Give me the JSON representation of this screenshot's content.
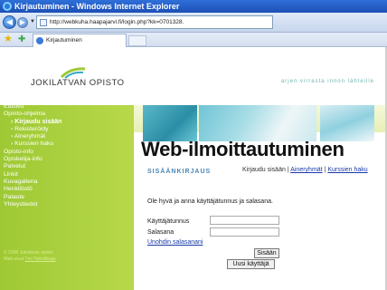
{
  "window": {
    "title": "Kirjautuminen - Windows Internet Explorer"
  },
  "addressbar": {
    "url": "http://webkuha.haapajarvi.fi/login.php?kk=0701328."
  },
  "tab": {
    "label": "Kirjautuminen"
  },
  "site": {
    "logo_text": "JOKILATVAN OPISTO",
    "tagline": "arjen virrasta innon lähteille"
  },
  "sidebar": {
    "items": [
      {
        "label": "Etusivu",
        "sub": false
      },
      {
        "label": "Opinto-ohjelma",
        "sub": false
      },
      {
        "label": "› Kirjaudu sisään",
        "sub": true,
        "active": true
      },
      {
        "label": "› Rekisteröidy",
        "sub": true
      },
      {
        "label": "› Aineryhmät",
        "sub": true
      },
      {
        "label": "› Kurssien haku",
        "sub": true
      },
      {
        "label": "Opisto-info",
        "sub": false
      },
      {
        "label": "Opiskelija-info",
        "sub": false
      },
      {
        "label": "Palvelut",
        "sub": false
      },
      {
        "label": "Linkit",
        "sub": false
      },
      {
        "label": "Kuvagalleria",
        "sub": false
      },
      {
        "label": "Henkilöstö",
        "sub": false
      },
      {
        "label": "Palaute",
        "sub": false
      },
      {
        "label": "Yhteystiedot",
        "sub": false
      }
    ],
    "footer_line1": "© 2008 Jokilatvan opisto",
    "footer_line2": "Web-sivut ",
    "footer_link": "Tmi Tekniikkaja"
  },
  "main": {
    "heading": "Web-ilmoittautuminen",
    "section_title": "SISÄÄNKIRJAUS",
    "links": {
      "login": "Kirjaudu sisään",
      "sep1": " | ",
      "groups": "Aineryhmät",
      "sep2": " | ",
      "search": "Kurssien haku"
    },
    "intro": "Ole hyvä ja anna käyttäjätunnus ja salasana.",
    "username_label": "Käyttäjätunnus",
    "password_label": "Salasana",
    "forgot": "Unohdin salasanani",
    "login_button": "Sisään",
    "register_button": "Uusi käyttäjä"
  },
  "colors": {
    "sidebar_green": "#9ec934",
    "section_blue": "#4a87b3",
    "link_blue": "#1a3aa8"
  }
}
